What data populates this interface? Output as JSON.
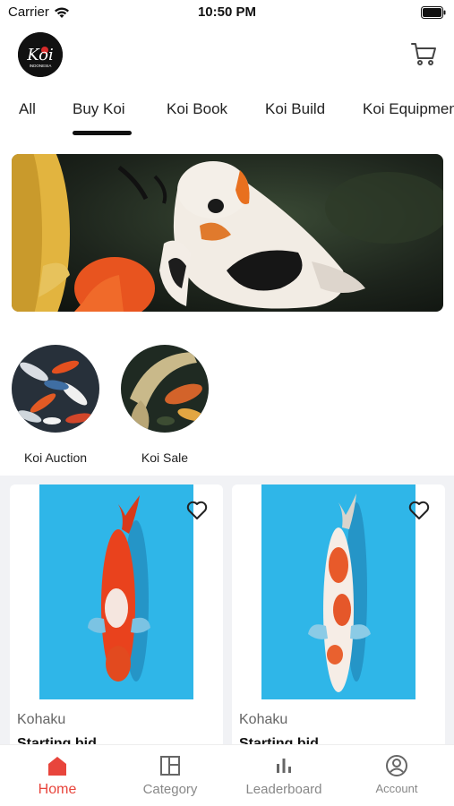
{
  "status_bar": {
    "carrier": "Carrier",
    "time": "10:50 PM"
  },
  "header": {
    "logo_text": "Koi",
    "logo_subtext": "INDONESIA"
  },
  "tabs": [
    {
      "label": "All"
    },
    {
      "label": "Buy Koi",
      "active": true
    },
    {
      "label": "Koi Book"
    },
    {
      "label": "Koi Build"
    },
    {
      "label": "Koi Equipment"
    }
  ],
  "categories": [
    {
      "label": "Koi Auction"
    },
    {
      "label": "Koi Sale"
    }
  ],
  "products": [
    {
      "name": "Kohaku",
      "bid_label": "Starting bid"
    },
    {
      "name": "Kohaku",
      "bid_label": "Starting bid"
    }
  ],
  "bottom_nav": [
    {
      "label": "Home",
      "icon": "home-icon",
      "active": true
    },
    {
      "label": "Category",
      "icon": "category-icon"
    },
    {
      "label": "Leaderboard",
      "icon": "leaderboard-icon"
    },
    {
      "label": "Account",
      "icon": "account-icon"
    }
  ],
  "colors": {
    "accent": "#e8453c",
    "text": "#222222",
    "muted": "#888888",
    "photo_bg": "#2fb6e8"
  }
}
